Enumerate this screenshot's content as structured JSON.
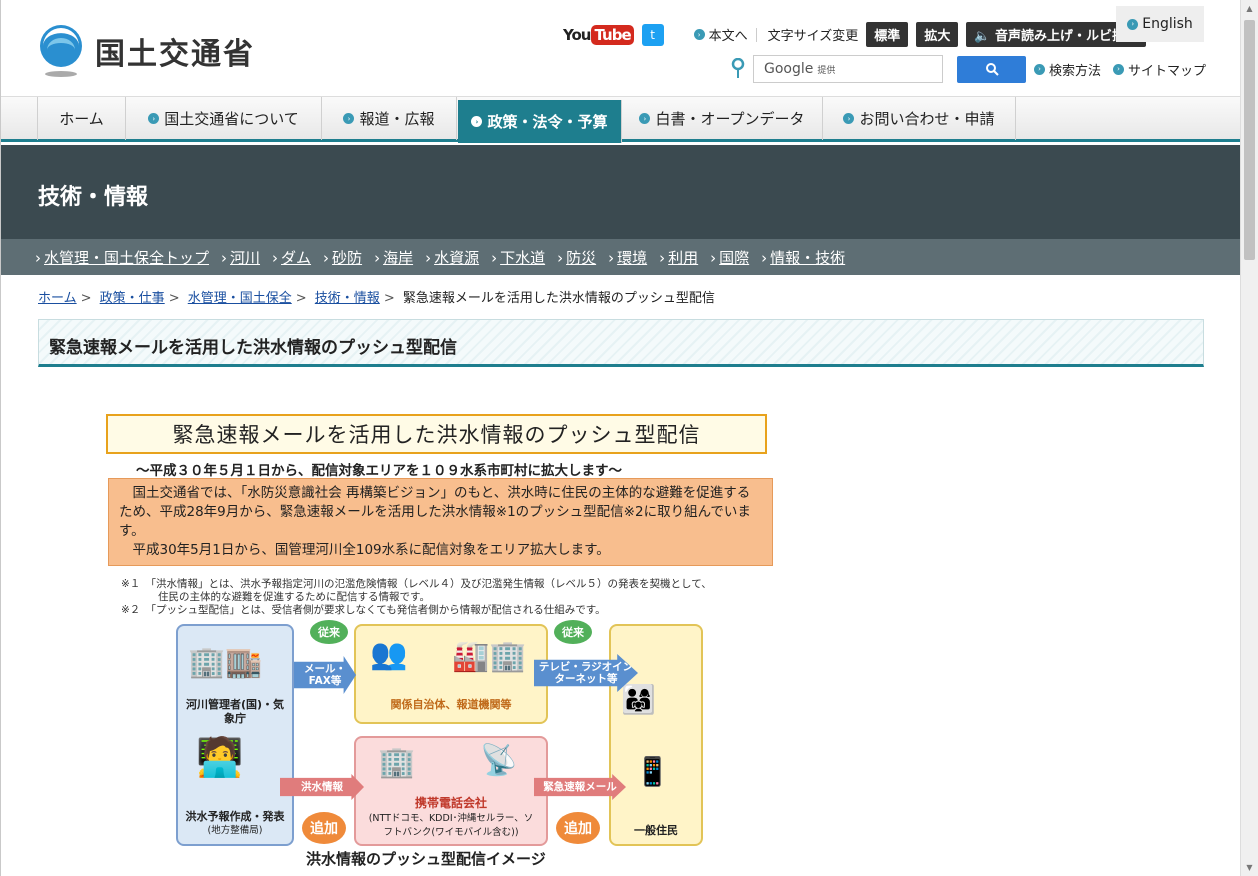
{
  "header": {
    "logo_text": "国土交通省",
    "youtube_you": "You",
    "youtube_tube": "Tube",
    "twitter_glyph": "t",
    "honbun": "本文へ",
    "font_size_label": "文字サイズ変更",
    "font_standard": "標準",
    "font_large": "拡大",
    "voice": "音声読み上げ・ルビ振り",
    "english": "English",
    "search_placeholder": "Google",
    "search_provided": "提供",
    "search_method": "検索方法",
    "sitemap": "サイトマップ"
  },
  "nav": [
    {
      "label": "ホーム"
    },
    {
      "label": "国土交通省について"
    },
    {
      "label": "報道・広報"
    },
    {
      "label": "政策・法令・予算"
    },
    {
      "label": "白書・オープンデータ"
    },
    {
      "label": "お問い合わせ・申請"
    }
  ],
  "band_title": "技術・情報",
  "subnav": [
    "水管理・国土保全トップ",
    "河川",
    "ダム",
    "砂防",
    "海岸",
    "水資源",
    "下水道",
    "防災",
    "環境",
    "利用",
    "国際",
    "情報・技術"
  ],
  "breadcrumb": {
    "items": [
      "ホーム",
      "政策・仕事",
      "水管理・国土保全",
      "技術・情報"
    ],
    "current": "緊急速報メールを活用した洪水情報のプッシュ型配信",
    "sep": ">"
  },
  "page_title": "緊急速報メールを活用した洪水情報のプッシュ型配信",
  "infographic": {
    "title": "緊急速報メールを活用した洪水情報のプッシュ型配信",
    "subtitle": "～平成３０年５月１日から、配信対象エリアを１０９水系市町村に拡大します～",
    "body1": "国土交通省では、「水防災意識社会 再構築ビジョン」のもと、洪水時に住民の主体的な避難を促進するため、平成28年9月から、緊急速報メールを活用した洪水情報※1のプッシュ型配信※2に取り組んでいます。",
    "body2": "平成30年5月1日から、国管理河川全109水系に配信対象をエリア拡大します。",
    "note1a": "※１　「洪水情報」とは、洪水予報指定河川の氾濫危険情報（レベル４）及び氾濫発生情報（レベル５）の発表を契機として、",
    "note1b": "住民の主体的な避難を促進するために配信する情報です。",
    "note2": "※２　「プッシュ型配信」とは、受信者側が要求しなくても発信者側から情報が配信される仕組みです。",
    "left_top_label": "河川管理者(国)・気象庁",
    "left_bottom_label": "洪水予報作成・発表",
    "left_bottom_sub": "(地方整備局)",
    "mid_top_label": "関係自治体、報道機関等",
    "mid_bottom_label": "携帯電話会社",
    "mid_bottom_sub": "(NTTドコモ、KDDI･沖縄セルラー、ソフトバンク(ワイモバイル含む))",
    "right_label": "一般住民",
    "arrow1": "メール・FAX等",
    "arrow2": "テレビ・ラジオインターネット等",
    "arrow3": "洪水情報",
    "arrow4": "緊急速報メール",
    "bubble_old": "従来",
    "bubble_new": "追加",
    "caption": "洪水情報のプッシュ型配信イメージ"
  },
  "colors": {
    "accent": "#1e7e8e",
    "band": "#3b4a50",
    "subnav": "#5e6e74"
  }
}
